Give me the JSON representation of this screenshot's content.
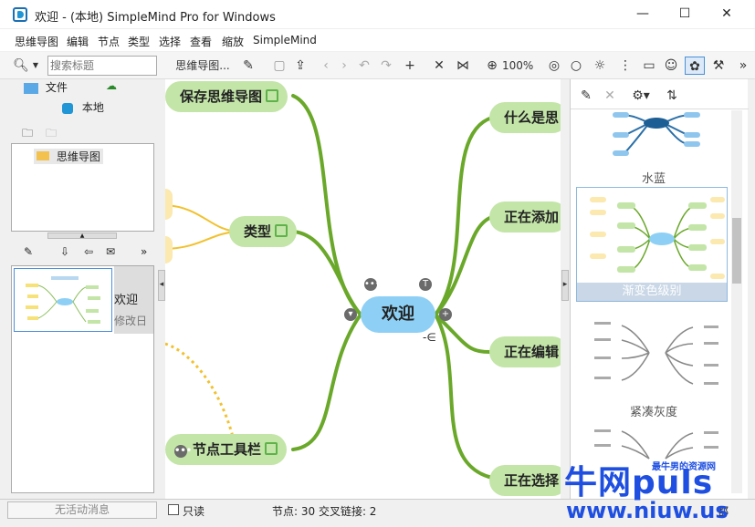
{
  "window": {
    "title": "欢迎 - (本地) SimpleMind Pro for Windows",
    "minimize": "—",
    "maximize": "☐",
    "close": "✕"
  },
  "menu": [
    "思维导图",
    "编辑",
    "节点",
    "类型",
    "选择",
    "查看",
    "缩放",
    "SimpleMind"
  ],
  "toolbar": {
    "search_placeholder": "搜索标题",
    "mindmap_dropdown": "思维导图...",
    "zoom": "100%"
  },
  "left": {
    "tab_files": "文件",
    "tab_local": "本地",
    "tree_item": "思维导图",
    "recent_title": "欢迎",
    "recent_subtitle": "修改日"
  },
  "canvas": {
    "center": "欢迎",
    "nodes": {
      "save": "保存思维导图",
      "type": "类型",
      "node_toolbar": "节点工具栏",
      "what_is": "什么是思",
      "adding": "正在添加",
      "editing": "正在编辑",
      "selecting": "正在选择"
    }
  },
  "right": {
    "themes": [
      {
        "name": "水蓝"
      },
      {
        "name": "渐变色级别",
        "selected": true
      },
      {
        "name": "紧凑灰度"
      }
    ]
  },
  "status": {
    "no_messages": "无活动消息",
    "readonly": "只读",
    "counts": "节点: 30 交叉链接: 2",
    "partial": "都"
  },
  "watermark": {
    "brand": "牛网puls",
    "tag": "最牛男的资源网",
    "url": "www.niuw.us"
  },
  "colors": {
    "branch": "#6aa82a",
    "yellow_branch": "#f2c12e",
    "node_fill": "#c3e5a8",
    "center_fill": "#8ed0f5"
  }
}
